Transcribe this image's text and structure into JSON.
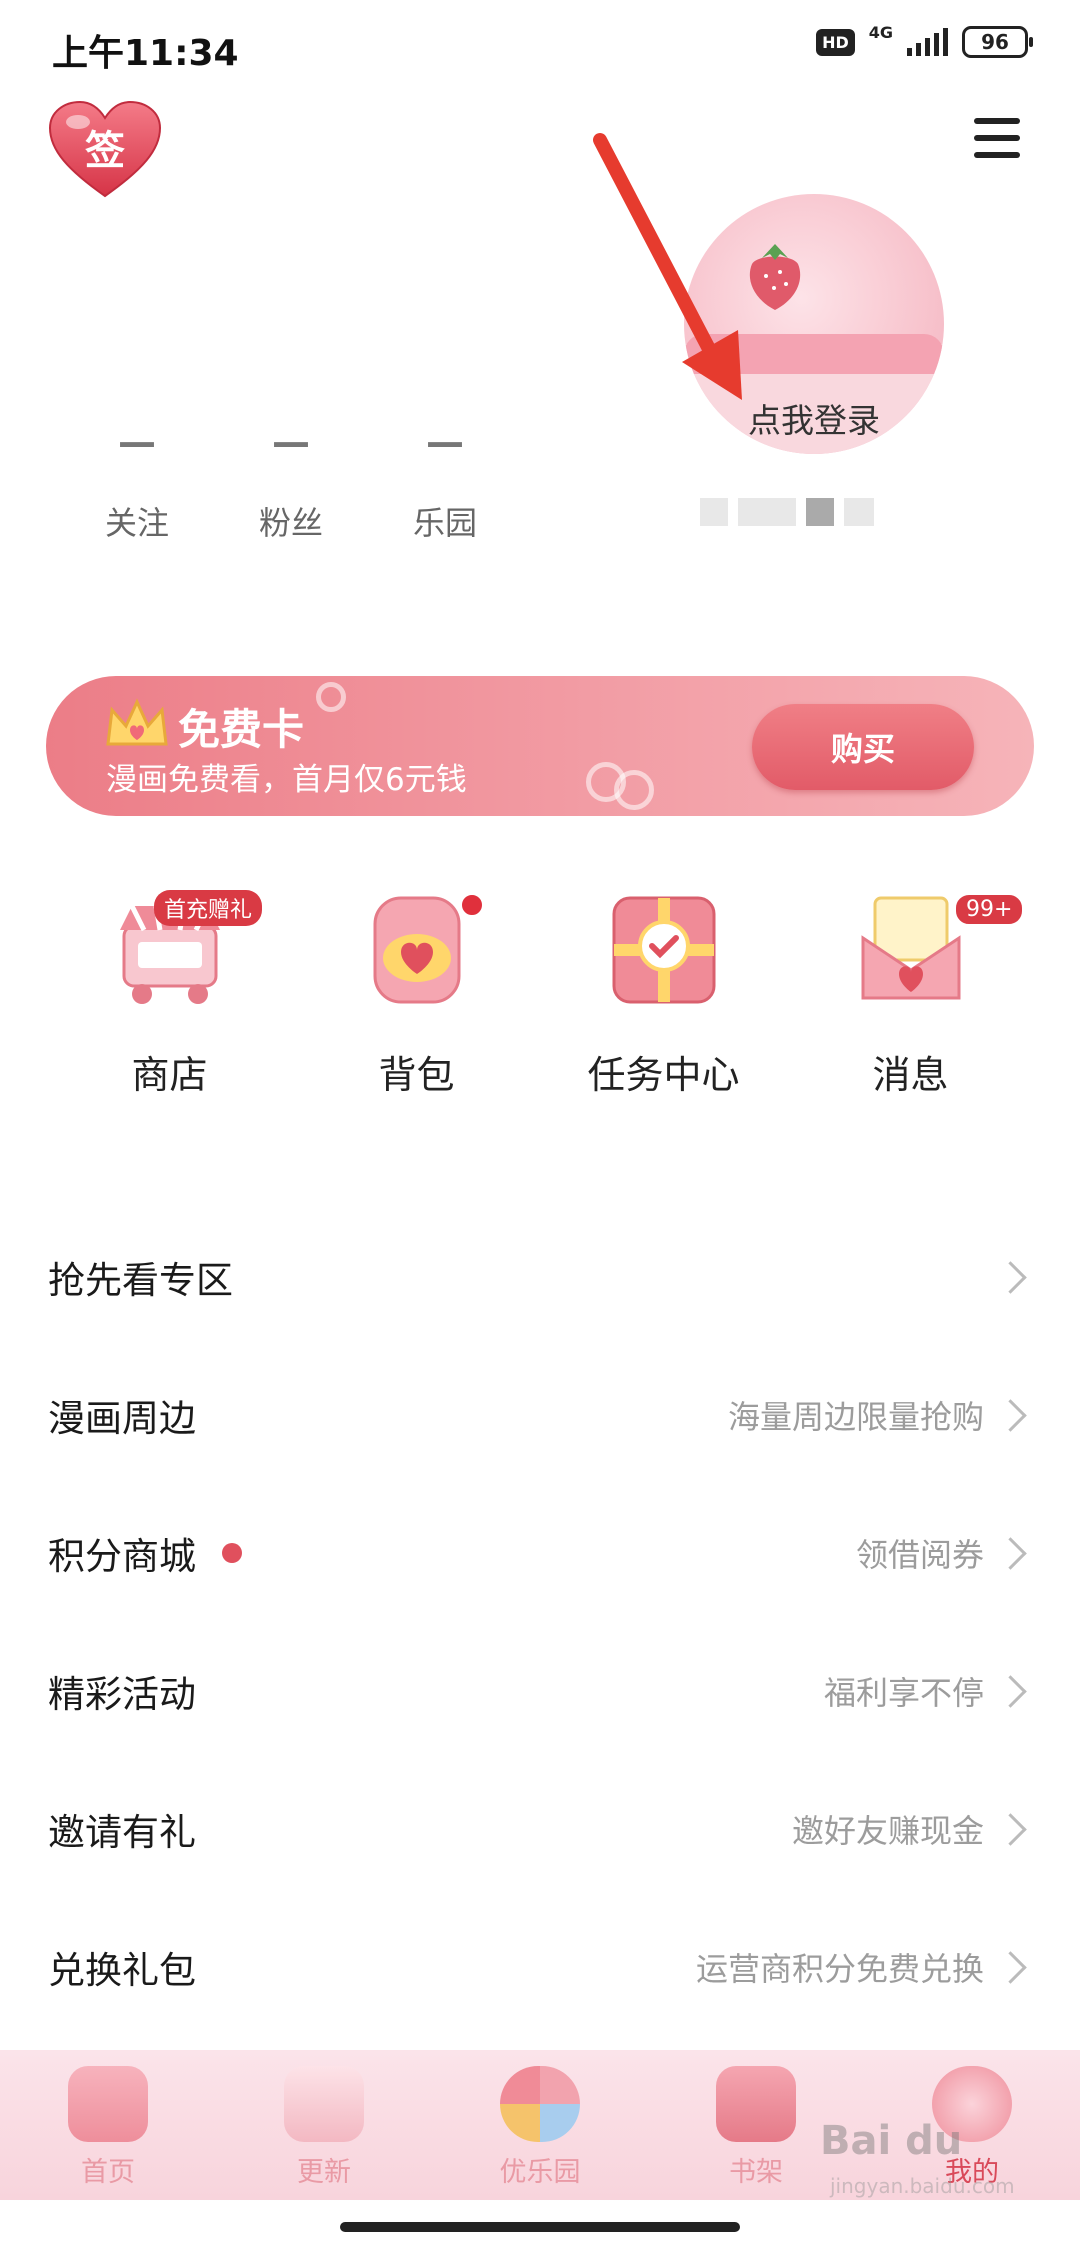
{
  "status": {
    "time": "上午11:34",
    "hd": "HD",
    "network": "4G",
    "battery": "96"
  },
  "header": {
    "sign_in": "签",
    "menu_icon": "hamburger-menu-icon"
  },
  "profile": {
    "login_prompt": "点我登录",
    "stats": [
      {
        "value": "—",
        "label": "关注"
      },
      {
        "value": "—",
        "label": "粉丝"
      },
      {
        "value": "—",
        "label": "乐园"
      }
    ]
  },
  "vip_banner": {
    "title": "免费卡",
    "subtitle": "漫画免费看，首月仅6元钱",
    "buy_label": "购买"
  },
  "shortcuts": [
    {
      "label": "商店",
      "badge": "首充赠礼",
      "icon": "shop-cart-icon"
    },
    {
      "label": "背包",
      "badge": "",
      "icon": "backpack-icon"
    },
    {
      "label": "任务中心",
      "badge": "",
      "icon": "task-center-icon"
    },
    {
      "label": "消息",
      "badge": "99+",
      "icon": "message-envelope-icon"
    }
  ],
  "menu": [
    {
      "title": "抢先看专区",
      "subtitle": ""
    },
    {
      "title": "漫画周边",
      "subtitle": "海量周边限量抢购"
    },
    {
      "title": "积分商城",
      "subtitle": "领借阅券"
    },
    {
      "title": "精彩活动",
      "subtitle": "福利享不停"
    },
    {
      "title": "邀请有礼",
      "subtitle": "邀好友赚现金"
    },
    {
      "title": "兑换礼包",
      "subtitle": "运营商积分免费兑换"
    }
  ],
  "bottom_nav": [
    {
      "label": "首页",
      "icon": "home-icon"
    },
    {
      "label": "更新",
      "icon": "update-bow-icon"
    },
    {
      "label": "优乐园",
      "icon": "pinwheel-icon"
    },
    {
      "label": "书架",
      "icon": "bookshelf-icon"
    },
    {
      "label": "我的",
      "icon": "profile-pouch-icon"
    }
  ],
  "colors": {
    "accent": "#e25b68",
    "banner": "#f29ca4",
    "nav_label": "#e99aa5"
  }
}
